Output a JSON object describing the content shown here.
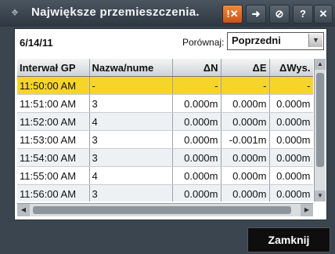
{
  "window": {
    "title": "Największe przemieszczenia.",
    "app_icon": "tripod-icon"
  },
  "toolbar": {
    "buttons": [
      {
        "name": "alert-button",
        "glyph": "!✕"
      },
      {
        "name": "navigate-button",
        "glyph": "➜"
      },
      {
        "name": "no-entry-button",
        "glyph": "⊘"
      },
      {
        "name": "help-button",
        "glyph": "?"
      },
      {
        "name": "close-window-button",
        "glyph": "✕"
      }
    ]
  },
  "header": {
    "date": "6/14/11",
    "compare_label": "Porównaj:",
    "compare_value": "Poprzedni"
  },
  "table": {
    "columns": [
      "Interwał GP",
      "Nazwa/nume",
      "ΔN",
      "ΔE",
      "ΔWys."
    ],
    "rows": [
      [
        "11:50:00 AM",
        "-",
        "-",
        "-",
        "-"
      ],
      [
        "11:51:00 AM",
        "3",
        "0.000m",
        "0.000m",
        "0.000m"
      ],
      [
        "11:52:00 AM",
        "4",
        "0.000m",
        "0.000m",
        "0.000m"
      ],
      [
        "11:53:00 AM",
        "3",
        "0.000m",
        "-0.001m",
        "0.000m"
      ],
      [
        "11:54:00 AM",
        "3",
        "0.000m",
        "0.000m",
        "0.000m"
      ],
      [
        "11:55:00 AM",
        "4",
        "0.000m",
        "0.000m",
        "0.000m"
      ],
      [
        "11:56:00 AM",
        "3",
        "0.000m",
        "0.000m",
        "0.000m"
      ]
    ]
  },
  "footer": {
    "close_label": "Zamknij"
  },
  "colors": {
    "selected_row": "#f6d52a",
    "alert_button": "#e06a2a"
  }
}
